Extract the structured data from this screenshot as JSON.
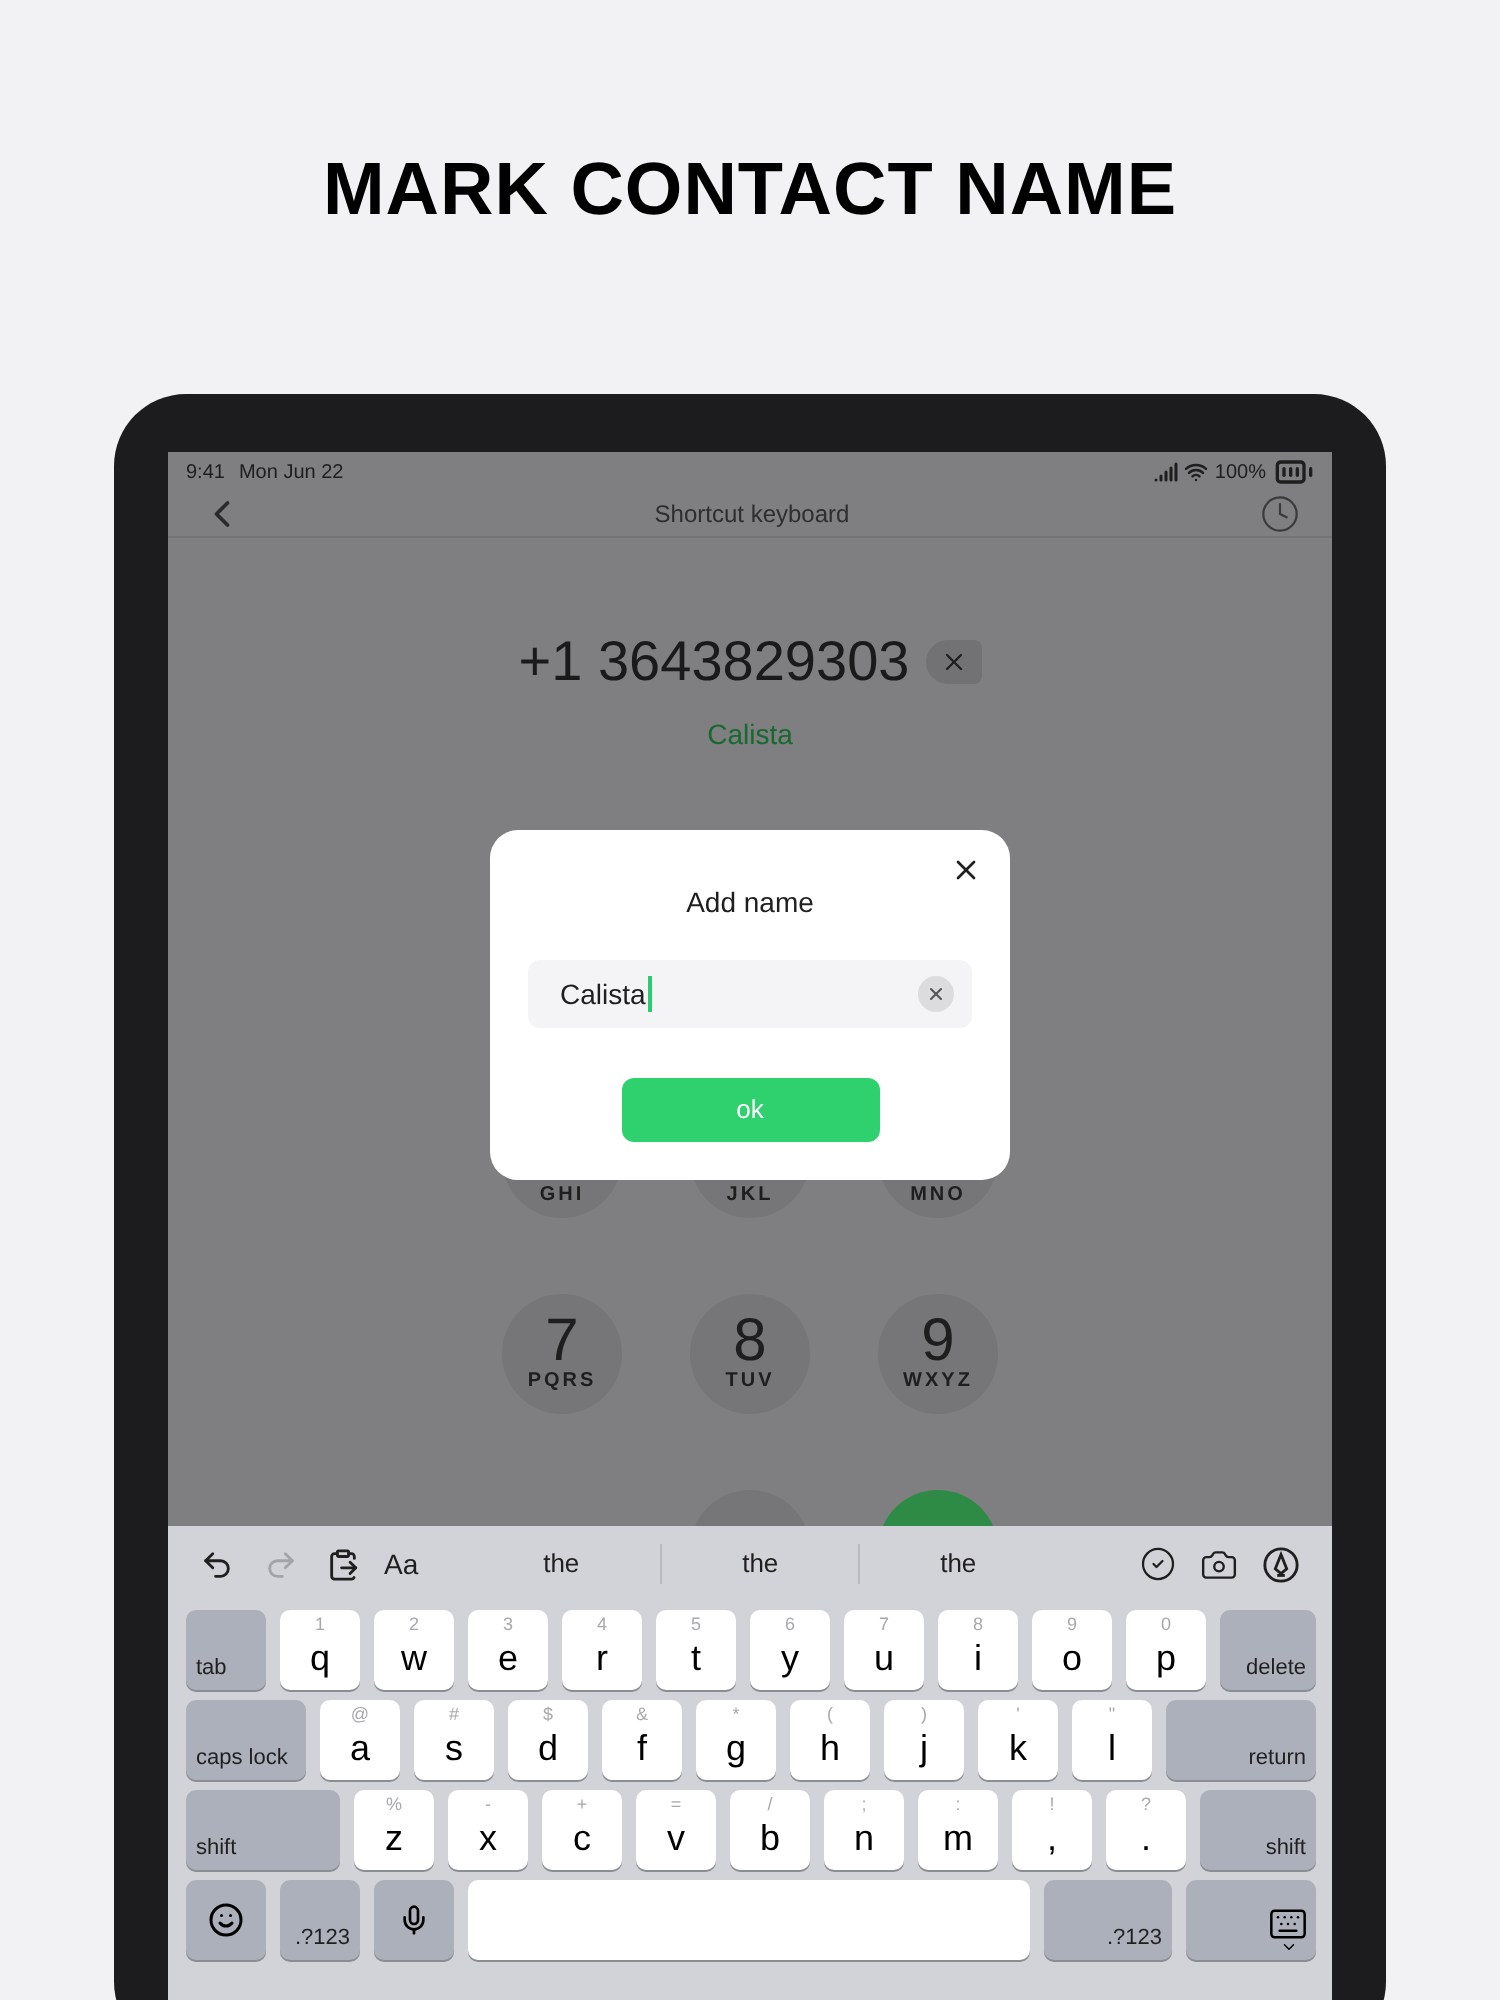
{
  "page_title": "MARK CONTACT NAME",
  "status_bar": {
    "time": "9:41",
    "date": "Mon Jun 22",
    "battery": "100%"
  },
  "nav": {
    "title": "Shortcut keyboard"
  },
  "dialer": {
    "number": "+1 3643829303",
    "contact_name": "Calista",
    "keypad_rows": [
      [
        {
          "kind": "digit",
          "letters": "GHI"
        },
        {
          "kind": "digit",
          "letters": "JKL"
        },
        {
          "kind": "digit",
          "letters": "MNO"
        }
      ],
      [
        {
          "kind": "digit",
          "digit": "7",
          "letters": "PQRS"
        },
        {
          "kind": "digit",
          "digit": "8",
          "letters": "TUV"
        },
        {
          "kind": "digit",
          "digit": "9",
          "letters": "WXYZ"
        }
      ],
      [
        {
          "kind": "blank"
        },
        {
          "kind": "digit"
        },
        {
          "kind": "call"
        }
      ]
    ]
  },
  "dialog": {
    "title": "Add name",
    "value": "Calista",
    "button": "ok"
  },
  "keyboard": {
    "toolbar": {
      "redo_disabled": true,
      "format": "Aa",
      "suggestions": [
        "the",
        "the",
        "the"
      ]
    },
    "rows": [
      [
        {
          "kind": "function",
          "label": "tab"
        },
        {
          "kind": "letter",
          "label": "q",
          "hint": "1"
        },
        {
          "kind": "letter",
          "label": "w",
          "hint": "2"
        },
        {
          "kind": "letter",
          "label": "e",
          "hint": "3"
        },
        {
          "kind": "letter",
          "label": "r",
          "hint": "4"
        },
        {
          "kind": "letter",
          "label": "t",
          "hint": "5"
        },
        {
          "kind": "letter",
          "label": "y",
          "hint": "6"
        },
        {
          "kind": "letter",
          "label": "u",
          "hint": "7"
        },
        {
          "kind": "letter",
          "label": "i",
          "hint": "8"
        },
        {
          "kind": "letter",
          "label": "o",
          "hint": "9"
        },
        {
          "kind": "letter",
          "label": "p",
          "hint": "0"
        },
        {
          "kind": "function",
          "label": "delete"
        }
      ],
      [
        {
          "kind": "function",
          "label": "caps lock"
        },
        {
          "kind": "letter",
          "label": "a",
          "hint": "@"
        },
        {
          "kind": "letter",
          "label": "s",
          "hint": "#"
        },
        {
          "kind": "letter",
          "label": "d",
          "hint": "$"
        },
        {
          "kind": "letter",
          "label": "f",
          "hint": "&"
        },
        {
          "kind": "letter",
          "label": "g",
          "hint": "*"
        },
        {
          "kind": "letter",
          "label": "h",
          "hint": "("
        },
        {
          "kind": "letter",
          "label": "j",
          "hint": ")"
        },
        {
          "kind": "letter",
          "label": "k",
          "hint": "'"
        },
        {
          "kind": "letter",
          "label": "l",
          "hint": "\""
        },
        {
          "kind": "function",
          "label": "return"
        }
      ],
      [
        {
          "kind": "function",
          "label": "shift"
        },
        {
          "kind": "letter",
          "label": "z",
          "hint": "%"
        },
        {
          "kind": "letter",
          "label": "x",
          "hint": "-"
        },
        {
          "kind": "letter",
          "label": "c",
          "hint": "+"
        },
        {
          "kind": "letter",
          "label": "v",
          "hint": "="
        },
        {
          "kind": "letter",
          "label": "b",
          "hint": "/"
        },
        {
          "kind": "letter",
          "label": "n",
          "hint": ";"
        },
        {
          "kind": "letter",
          "label": "m",
          "hint": ":"
        },
        {
          "kind": "letter",
          "label": ",",
          "hint": "!"
        },
        {
          "kind": "letter",
          "label": ".",
          "hint": "?"
        },
        {
          "kind": "function",
          "label": "shift"
        }
      ]
    ],
    "bottom_row": [
      {
        "kind": "emoji"
      },
      {
        "kind": "function",
        "label": ".?123"
      },
      {
        "kind": "dictation"
      },
      {
        "kind": "space"
      },
      {
        "kind": "function",
        "label": ".?123"
      },
      {
        "kind": "dismiss"
      }
    ]
  }
}
